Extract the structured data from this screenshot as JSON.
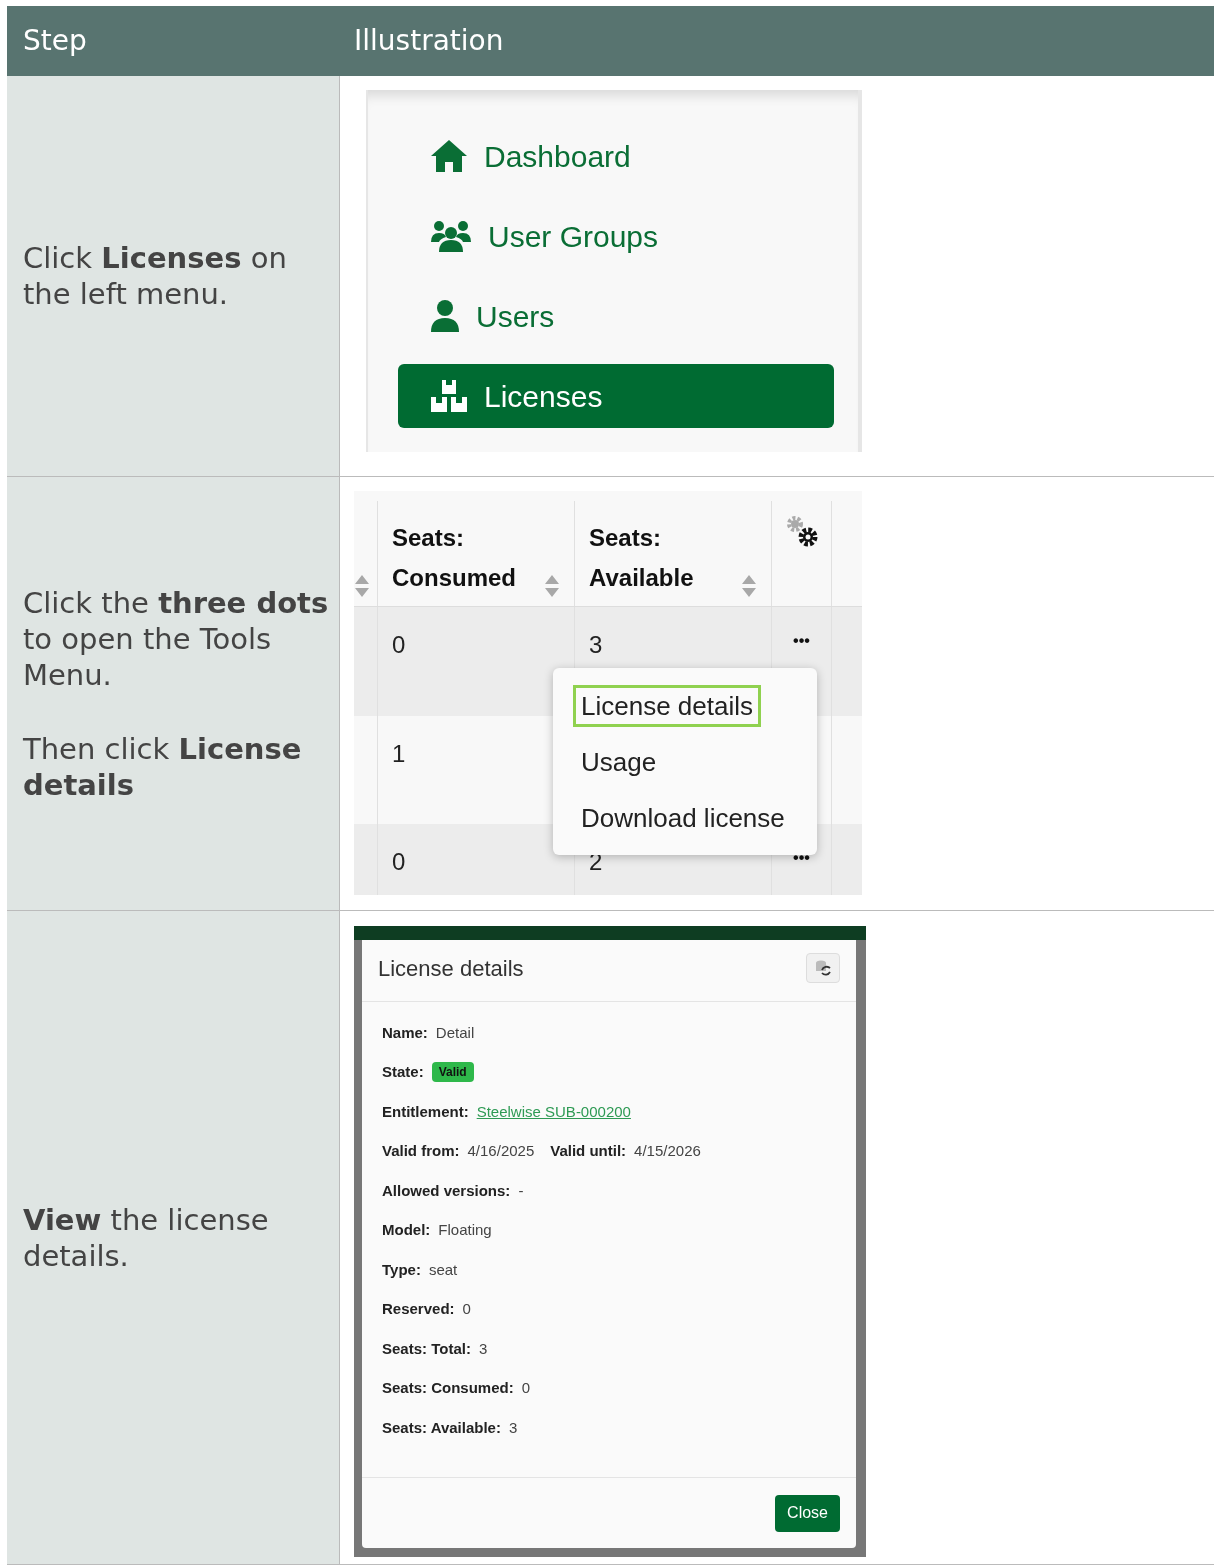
{
  "header": {
    "columns": [
      "Step",
      "Illustration"
    ]
  },
  "steps": [
    {
      "kind": "menu",
      "instruction": [
        "Click **Licenses** on the left menu."
      ],
      "menu_items": [
        {
          "label": "Dashboard",
          "selected": false
        },
        {
          "label": "User Groups",
          "selected": false
        },
        {
          "label": "Users",
          "selected": false
        },
        {
          "label": "Licenses",
          "selected": true
        }
      ]
    },
    {
      "kind": "table",
      "instruction": [
        "Click the **three dots** to open the Tools Menu.",
        "Then click **License details**"
      ],
      "columns": [
        "Seats: Consumed",
        "Seats: Available"
      ],
      "rows": [
        {
          "cells": [
            "0",
            "3"
          ],
          "actions": "•••"
        },
        {
          "cells": [
            "1"
          ]
        },
        {
          "cells": [
            "0",
            "2"
          ],
          "actions": "•••"
        }
      ],
      "tools_menu": [
        {
          "label": "License details",
          "selected": true
        },
        {
          "label": "Usage",
          "selected": false
        },
        {
          "label": "Download license",
          "selected": false
        }
      ]
    },
    {
      "kind": "dialog",
      "instruction": [
        "**View** the license details."
      ],
      "dialog": {
        "title": "License details",
        "lines": [
          [
            {
              "label": "Name:",
              "value": "Detail",
              "kind": "text"
            }
          ],
          [
            {
              "label": "State:",
              "value": "Valid",
              "kind": "badge"
            }
          ],
          [
            {
              "label": "Entitlement:",
              "value": "Steelwise SUB-000200",
              "kind": "link"
            }
          ],
          [
            {
              "label": "Valid from:",
              "value": "4/16/2025",
              "kind": "text"
            },
            {
              "label": "Valid until:",
              "value": "4/15/2026",
              "kind": "text"
            }
          ],
          [
            {
              "label": "Allowed versions:",
              "value": "-",
              "kind": "text"
            }
          ],
          [
            {
              "label": "Model:",
              "value": "Floating",
              "kind": "text"
            }
          ],
          [
            {
              "label": "Type:",
              "value": "seat",
              "kind": "text"
            }
          ],
          [
            {
              "label": "Reserved:",
              "value": "0",
              "kind": "text"
            }
          ],
          [
            {
              "label": "Seats: Total:",
              "value": "3",
              "kind": "text"
            }
          ],
          [
            {
              "label": "Seats: Consumed:",
              "value": "0",
              "kind": "text"
            }
          ],
          [
            {
              "label": "Seats: Available:",
              "value": "3",
              "kind": "text"
            }
          ]
        ],
        "button": "Close"
      }
    }
  ]
}
